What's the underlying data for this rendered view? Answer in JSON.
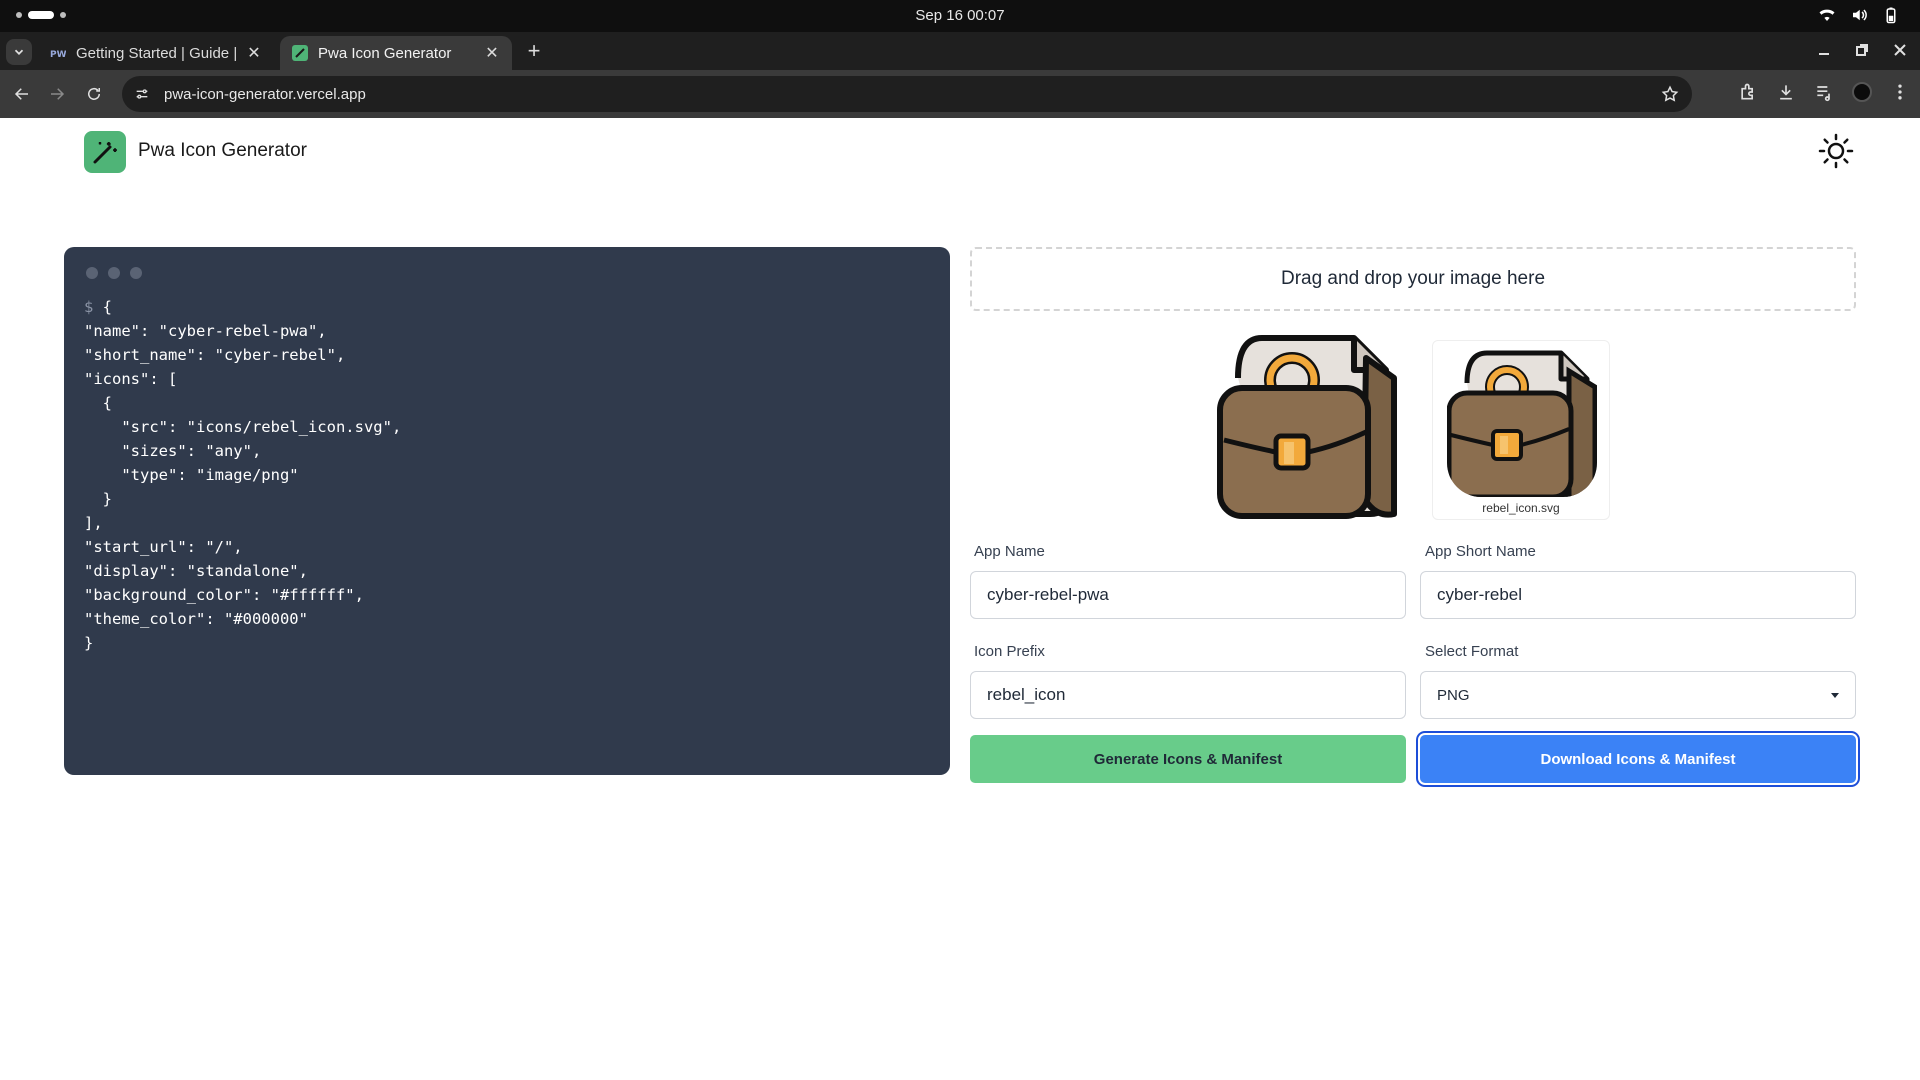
{
  "os": {
    "clock": "Sep 16  00:07"
  },
  "browser": {
    "tabs": [
      {
        "label": "Getting Started | Guide |",
        "active": false
      },
      {
        "label": "Pwa Icon Generator",
        "active": true
      }
    ],
    "url": "pwa-icon-generator.vercel.app"
  },
  "app": {
    "title": "Pwa Icon Generator",
    "accent": "#4fb477"
  },
  "code": {
    "prompt": "$",
    "text": " {\n\"name\": \"cyber-rebel-pwa\",\n\"short_name\": \"cyber-rebel\",\n\"icons\": [\n  {\n    \"src\": \"icons/rebel_icon.svg\",\n    \"sizes\": \"any\",\n    \"type\": \"image/png\"\n  }\n],\n\"start_url\": \"/\",\n\"display\": \"standalone\",\n\"background_color\": \"#ffffff\",\n\"theme_color\": \"#000000\"\n}"
  },
  "dropzone": {
    "label": "Drag and drop your image here"
  },
  "preview": {
    "filename": "rebel_icon.svg"
  },
  "form": {
    "app_name_label": "App Name",
    "app_name_value": "cyber-rebel-pwa",
    "short_name_label": "App Short Name",
    "short_name_value": "cyber-rebel",
    "prefix_label": "Icon Prefix",
    "prefix_value": "rebel_icon",
    "format_label": "Select Format",
    "format_value": "PNG"
  },
  "buttons": {
    "generate": "Generate Icons & Manifest",
    "download": "Download Icons & Manifest",
    "generate_color": "#68cc8a",
    "download_color": "#3b82f6"
  }
}
